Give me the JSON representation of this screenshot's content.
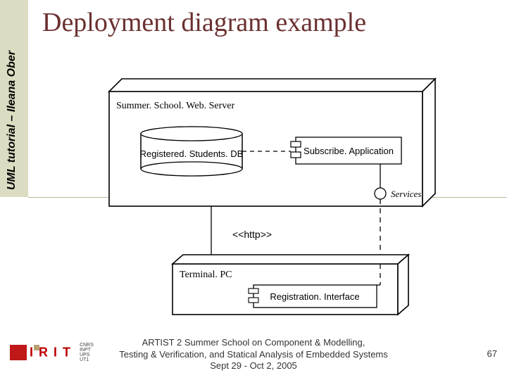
{
  "side_text": "UML tutorial – Ileana Ober",
  "title": "Deployment diagram example",
  "node1": {
    "name": "Summer. School. Web. Server",
    "db": "Registered. Students. DB",
    "component": "Subscribe. Application",
    "interface": "Services"
  },
  "link_label": "<<http>>",
  "node2": {
    "name": "Terminal. PC",
    "component": "Registration. Interface"
  },
  "footer_line1": "ARTIST 2 Summer School on Component & Modelling,",
  "footer_line2": "Testing & Verification, and Statical Analysis of Embedded Systems",
  "footer_line3": "Sept 29 - Oct 2, 2005",
  "page_number": "67",
  "logo_text": "IRIT",
  "logo_affil": "CNRS\nINPT\nUPS\nUT1"
}
